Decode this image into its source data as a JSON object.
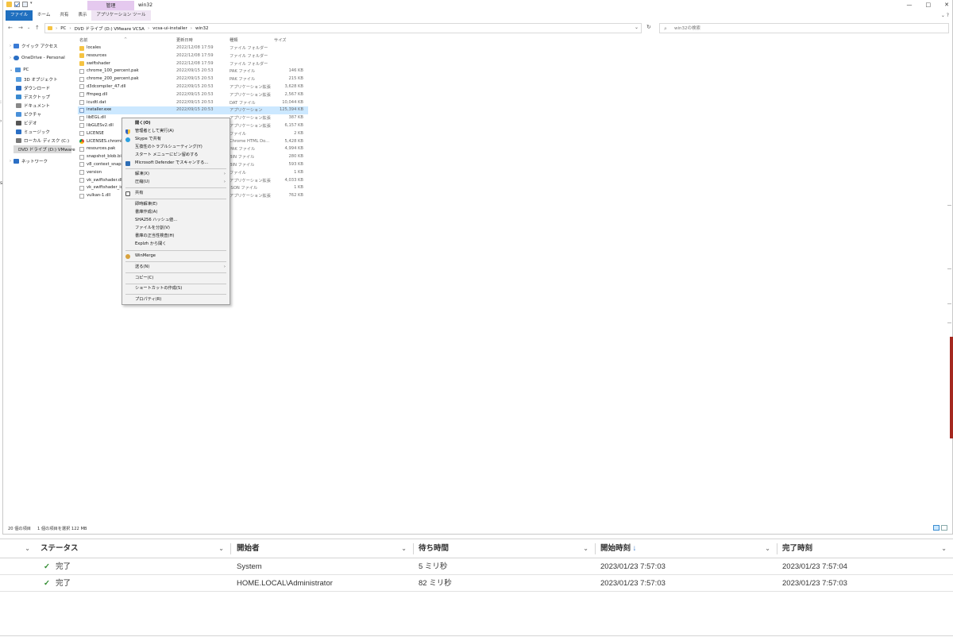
{
  "window": {
    "title": "win32",
    "contextual_tab_group": "管理",
    "controls": {
      "minimize": "—",
      "maximize": "□",
      "close": "✕"
    }
  },
  "ribbon": {
    "tabs": [
      "ファイル",
      "ホーム",
      "共有",
      "表示",
      "アプリケーション ツール"
    ]
  },
  "address": {
    "crumbs": [
      "PC",
      "DVD ドライブ (D:) VMware VCSA",
      "vcsa-ui-installer",
      "win32"
    ],
    "search_placeholder": "win32の検索"
  },
  "navpane": {
    "items": [
      {
        "label": "クイック アクセス",
        "icon": "star-icon",
        "color": "#3a7bd5"
      },
      {
        "label": "OneDrive - Personal",
        "icon": "cloud-icon",
        "color": "#2b6fc4"
      },
      {
        "label": "PC",
        "icon": "pc-icon",
        "color": "#4a8fd8"
      },
      {
        "label": "3D オブジェクト",
        "icon": "cube-icon",
        "color": "#5aa0e0"
      },
      {
        "label": "ダウンロード",
        "icon": "download-icon",
        "color": "#2b6fc4"
      },
      {
        "label": "デスクトップ",
        "icon": "desktop-icon",
        "color": "#3a8ad0"
      },
      {
        "label": "ドキュメント",
        "icon": "documents-icon",
        "color": "#888888"
      },
      {
        "label": "ピクチャ",
        "icon": "pictures-icon",
        "color": "#4a90d9"
      },
      {
        "label": "ビデオ",
        "icon": "video-icon",
        "color": "#555555"
      },
      {
        "label": "ミュージック",
        "icon": "music-icon",
        "color": "#2b6fc4"
      },
      {
        "label": "ローカル ディスク (C:)",
        "icon": "disk-icon",
        "color": "#777777"
      },
      {
        "label": "DVD ドライブ (D:) VMware",
        "icon": "dvd-icon",
        "color": "#999999"
      },
      {
        "label": "ネットワーク",
        "icon": "network-icon",
        "color": "#2b6fc4"
      }
    ]
  },
  "filelist": {
    "headers": {
      "name": "名前",
      "date": "更新日時",
      "type": "種類",
      "size": "サイズ"
    },
    "rows": [
      {
        "name": "locales",
        "date": "2022/12/08 17:59",
        "type": "ファイル フォルダー",
        "size": "",
        "kind": "folder"
      },
      {
        "name": "resources",
        "date": "2022/12/08 17:59",
        "type": "ファイル フォルダー",
        "size": "",
        "kind": "folder"
      },
      {
        "name": "swiftshader",
        "date": "2022/12/08 17:59",
        "type": "ファイル フォルダー",
        "size": "",
        "kind": "folder"
      },
      {
        "name": "chrome_100_percent.pak",
        "date": "2022/09/15 20:53",
        "type": "PAK ファイル",
        "size": "146 KB",
        "kind": "file"
      },
      {
        "name": "chrome_200_percent.pak",
        "date": "2022/09/15 20:53",
        "type": "PAK ファイル",
        "size": "215 KB",
        "kind": "file"
      },
      {
        "name": "d3dcompiler_47.dll",
        "date": "2022/09/15 20:53",
        "type": "アプリケーション拡張",
        "size": "3,628 KB",
        "kind": "file"
      },
      {
        "name": "ffmpeg.dll",
        "date": "2022/09/15 20:53",
        "type": "アプリケーション拡張",
        "size": "2,567 KB",
        "kind": "file"
      },
      {
        "name": "icudtl.dat",
        "date": "2022/09/15 20:53",
        "type": "DAT ファイル",
        "size": "10,044 KB",
        "kind": "file"
      },
      {
        "name": "installer.exe",
        "date": "2022/09/15 20:53",
        "type": "アプリケーション",
        "size": "125,394 KB",
        "kind": "exe",
        "selected": true
      },
      {
        "name": "libEGL.dll",
        "date": "",
        "type": "アプリケーション拡張",
        "size": "387 KB",
        "kind": "file"
      },
      {
        "name": "libGLESv2.dll",
        "date": "",
        "type": "アプリケーション拡張",
        "size": "6,157 KB",
        "kind": "file"
      },
      {
        "name": "LICENSE",
        "date": "",
        "type": "ファイル",
        "size": "2 KB",
        "kind": "file"
      },
      {
        "name": "LICENSES.chromium",
        "date": "",
        "type": "Chrome HTML Do...",
        "size": "5,428 KB",
        "kind": "chrome"
      },
      {
        "name": "resources.pak",
        "date": "",
        "type": "PAK ファイル",
        "size": "4,994 KB",
        "kind": "file"
      },
      {
        "name": "snapshot_blob.bin",
        "date": "",
        "type": "BIN ファイル",
        "size": "280 KB",
        "kind": "file"
      },
      {
        "name": "v8_context_snapshot",
        "date": "",
        "type": "BIN ファイル",
        "size": "593 KB",
        "kind": "file"
      },
      {
        "name": "version",
        "date": "",
        "type": "ファイル",
        "size": "1 KB",
        "kind": "file"
      },
      {
        "name": "vk_swiftshader.dll",
        "date": "",
        "type": "アプリケーション拡張",
        "size": "4,033 KB",
        "kind": "file"
      },
      {
        "name": "vk_swiftshader_ic",
        "date": "",
        "type": "JSON ファイル",
        "size": "1 KB",
        "kind": "file"
      },
      {
        "name": "vulkan-1.dll",
        "date": "",
        "type": "アプリケーション拡張",
        "size": "762 KB",
        "kind": "file"
      }
    ]
  },
  "statusbar": {
    "count": "20 個の項目",
    "selection": "1 個の項目を選択  122 MB"
  },
  "context_menu": {
    "items": [
      {
        "label": "開く(O)",
        "bold": true
      },
      {
        "label": "管理者として実行(A)",
        "icon": "shield-icon"
      },
      {
        "label": "Skype で共有",
        "icon": "skype-icon"
      },
      {
        "label": "互換性のトラブルシューティング(Y)"
      },
      {
        "label": "スタート メニューにピン留めする"
      },
      {
        "label": "Microsoft Defender でスキャンする...",
        "icon": "defender-icon"
      },
      {
        "label": "解凍(X)",
        "submenu": true
      },
      {
        "label": "圧縮(U)",
        "submenu": true
      },
      {
        "label": "共有",
        "icon": "share-icon"
      },
      {
        "label": "即時解凍(E)"
      },
      {
        "label": "書庫作成(A)"
      },
      {
        "label": "SHA256 ハッシュ値..."
      },
      {
        "label": "ファイルを分割(V)"
      },
      {
        "label": "書庫の正当性検査(H)"
      },
      {
        "label": "Explzh から開く"
      },
      {
        "label": "WinMerge",
        "icon": "winmerge-icon"
      },
      {
        "label": "送る(N)",
        "submenu": true
      },
      {
        "label": "コピー(C)"
      },
      {
        "label": "ショートカットの作成(S)"
      },
      {
        "label": "プロパティ(R)"
      }
    ]
  },
  "tasks": {
    "headers": {
      "status": "ステータス",
      "initiator": "開始者",
      "wait": "待ち時間",
      "start": "開始時刻",
      "end": "完了時刻"
    },
    "sort_indicator": "↓",
    "rows": [
      {
        "status": "完了",
        "initiator": "System",
        "wait": "5 ミリ秒",
        "start": "2023/01/23 7:57:03",
        "end": "2023/01/23 7:57:04"
      },
      {
        "status": "完了",
        "initiator": "HOME.LOCAL\\Administrator",
        "wait": "82 ミリ秒",
        "start": "2023/01/23 7:57:03",
        "end": "2023/01/23 7:57:03"
      }
    ]
  },
  "colors": {
    "selection": "#cce8ff",
    "accent": "#1f6fbf",
    "manage_tab": "#e5c9ef",
    "ok": "#2e8b2e",
    "edge_red": "#a4281f"
  }
}
